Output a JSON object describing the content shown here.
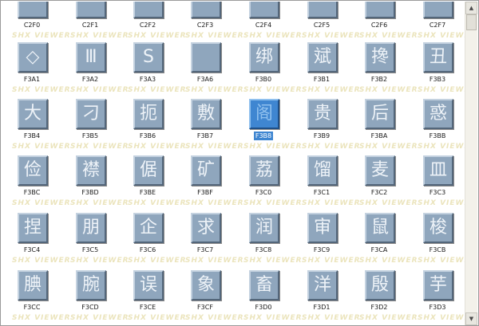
{
  "watermark": "SHX VIEWER",
  "colors": {
    "tile": "#8fa6bd",
    "tile_selected": "#3f86d1",
    "watermark": "#ebe4bc"
  },
  "scrollbar": {
    "up_icon": "triangle-up",
    "down_icon": "triangle-down",
    "up_glyph": "▲",
    "down_glyph": "▼"
  },
  "selected_code": "F3B8",
  "rows": [
    [
      {
        "glyph": "",
        "code": "C2F0"
      },
      {
        "glyph": "",
        "code": "C2F1"
      },
      {
        "glyph": "",
        "code": "C2F2"
      },
      {
        "glyph": "",
        "code": "C2F3"
      },
      {
        "glyph": "",
        "code": "C2F4"
      },
      {
        "glyph": "",
        "code": "C2F5"
      },
      {
        "glyph": "",
        "code": "C2F6"
      },
      {
        "glyph": "",
        "code": "C2F7"
      }
    ],
    [
      {
        "glyph": "◇",
        "code": "F3A1"
      },
      {
        "glyph": "Ⅲ",
        "code": "F3A2"
      },
      {
        "glyph": "S",
        "code": "F3A3"
      },
      {
        "glyph": "",
        "code": "F3A6"
      },
      {
        "glyph": "绑",
        "code": "F3B0"
      },
      {
        "glyph": "斌",
        "code": "F3B1"
      },
      {
        "glyph": "搀",
        "code": "F3B2"
      },
      {
        "glyph": "丑",
        "code": "F3B3"
      }
    ],
    [
      {
        "glyph": "大",
        "code": "F3B4"
      },
      {
        "glyph": "刁",
        "code": "F3B5"
      },
      {
        "glyph": "扼",
        "code": "F3B6"
      },
      {
        "glyph": "敷",
        "code": "F3B7"
      },
      {
        "glyph": "阁",
        "code": "F3B8"
      },
      {
        "glyph": "贵",
        "code": "F3B9"
      },
      {
        "glyph": "后",
        "code": "F3BA"
      },
      {
        "glyph": "惑",
        "code": "F3BB"
      }
    ],
    [
      {
        "glyph": "俭",
        "code": "F3BC"
      },
      {
        "glyph": "襟",
        "code": "F3BD"
      },
      {
        "glyph": "倨",
        "code": "F3BE"
      },
      {
        "glyph": "矿",
        "code": "F3BF"
      },
      {
        "glyph": "荔",
        "code": "F3C0"
      },
      {
        "glyph": "馏",
        "code": "F3C1"
      },
      {
        "glyph": "麦",
        "code": "F3C2"
      },
      {
        "glyph": "皿",
        "code": "F3C3"
      }
    ],
    [
      {
        "glyph": "捏",
        "code": "F3C4"
      },
      {
        "glyph": "朋",
        "code": "F3C5"
      },
      {
        "glyph": "企",
        "code": "F3C6"
      },
      {
        "glyph": "求",
        "code": "F3C7"
      },
      {
        "glyph": "润",
        "code": "F3C8"
      },
      {
        "glyph": "审",
        "code": "F3C9"
      },
      {
        "glyph": "鼠",
        "code": "F3CA"
      },
      {
        "glyph": "梭",
        "code": "F3CB"
      }
    ],
    [
      {
        "glyph": "腆",
        "code": "F3CC"
      },
      {
        "glyph": "腕",
        "code": "F3CD"
      },
      {
        "glyph": "误",
        "code": "F3CE"
      },
      {
        "glyph": "象",
        "code": "F3CF"
      },
      {
        "glyph": "畜",
        "code": "F3D0"
      },
      {
        "glyph": "洋",
        "code": "F3D1"
      },
      {
        "glyph": "殷",
        "code": "F3D2"
      },
      {
        "glyph": "芋",
        "code": "F3D3"
      }
    ]
  ]
}
